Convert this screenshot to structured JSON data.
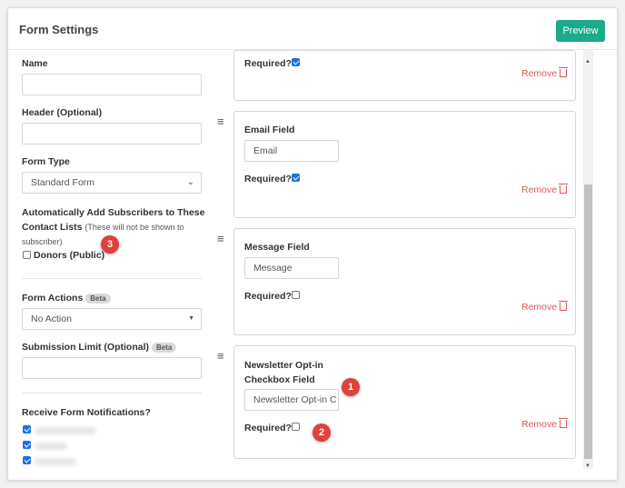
{
  "header": {
    "title": "Form Settings",
    "preview_label": "Preview"
  },
  "left": {
    "name_label": "Name",
    "name_value": "",
    "header_label": "Header (Optional)",
    "header_value": "",
    "form_type_label": "Form Type",
    "form_type_value": "Standard Form",
    "auto_add_label_1": "Automatically Add Subscribers to These",
    "auto_add_label_2": "Contact Lists",
    "auto_add_note_1": "(These will not be shown to",
    "auto_add_note_2": "subscriber)",
    "donors_label": "Donors (Public)",
    "donors_checked": false,
    "form_actions_label": "Form Actions",
    "beta_badge": "Beta",
    "form_actions_value": "No Action",
    "submission_limit_label": "Submission Limit (Optional)",
    "submission_limit_value": "",
    "notifications_label": "Receive Form Notifications?",
    "notification_checks": [
      true,
      true,
      true
    ]
  },
  "fields": [
    {
      "title": "",
      "required_label": "Required?",
      "required": true,
      "remove_label": "Remove"
    },
    {
      "title": "Email Field",
      "input_value": "Email",
      "required_label": "Required?",
      "required": true,
      "remove_label": "Remove"
    },
    {
      "title": "Message Field",
      "input_value": "Message",
      "required_label": "Required?",
      "required": false,
      "remove_label": "Remove"
    },
    {
      "title_line1": "Newsletter Opt-in",
      "title_line2": "Checkbox Field",
      "input_value": "Newsletter Opt-in C",
      "required_label": "Required?",
      "required": false,
      "remove_label": "Remove"
    }
  ],
  "markers": [
    "1",
    "2",
    "3"
  ],
  "colors": {
    "accent": "#1aab8b",
    "remove": "#e2555b",
    "marker": "#e0403d",
    "checkbox": "#1a73e8"
  },
  "icons": {
    "handle": "drag-handle-icon",
    "trash": "trash-icon",
    "select": "chevron-down-icon"
  }
}
